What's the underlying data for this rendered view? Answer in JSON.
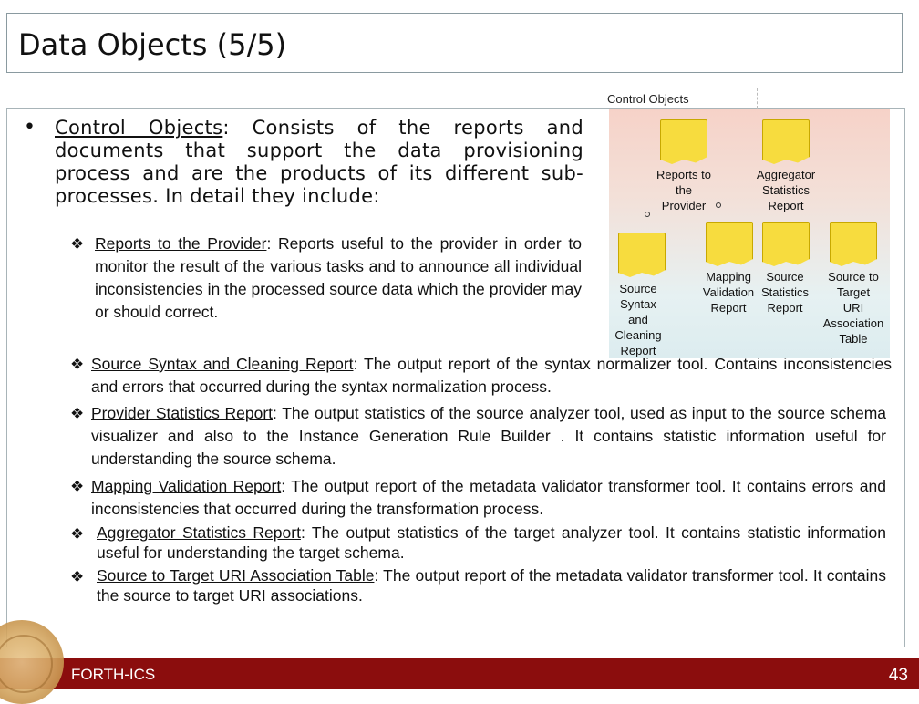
{
  "slide": {
    "title": "Data Objects (5/5)",
    "footer_org": "FORTH-ICS",
    "page_number": "43"
  },
  "intro": {
    "bullet": "•",
    "term": "Control Objects",
    "colon": ":",
    "text": " Consists of the reports and documents that support the data provisioning process and are the products of its different sub-processes. In detail they include:"
  },
  "items": [
    {
      "term": "Reports to the Provider",
      "text": ": Reports useful to the provider in order to monitor the result of the various tasks and to announce all individual inconsistencies in the processed source data which the provider may or should correct."
    },
    {
      "term": "Source Syntax and Cleaning Report",
      "text": ": The output report of the syntax normalizer tool. Contains inconsistencies and errors that occurred during the syntax normalization process."
    },
    {
      "term": "Provider Statistics Report",
      "text": ": The output statistics of the source analyzer tool, used as input to the source schema visualizer and also to the Instance Generation Rule Builder . It contains statistic information useful for understanding the source schema."
    },
    {
      "term": "Mapping Validation Report",
      "text": ": The output report of the metadata validator transformer tool. It contains errors and inconsistencies that occurred during the transformation process."
    },
    {
      "term": "Aggregator Statistics Report",
      "text": ": The output statistics of the target analyzer tool. It contains statistic information useful for understanding the target schema."
    },
    {
      "term": "Source to Target URI Association Table",
      "text": ": The output report of the metadata validator transformer tool. It contains the source to target URI associations."
    }
  ],
  "diamond": "❖",
  "diagram": {
    "label": "Control Objects",
    "docs": [
      {
        "label": "Reports to\nthe\nProvider"
      },
      {
        "label": "Aggregator\nStatistics\nReport"
      },
      {
        "label": "Source\nSyntax\nand\nCleaning\nReport"
      },
      {
        "label": "Mapping\nValidation\nReport"
      },
      {
        "label": "Source\nStatistics\nReport"
      },
      {
        "label": "Source to\nTarget\nURI\nAssociation\nTable"
      }
    ]
  },
  "colors": {
    "footer": "#8b0d0d",
    "doc_fill": "#f7dc3e"
  }
}
